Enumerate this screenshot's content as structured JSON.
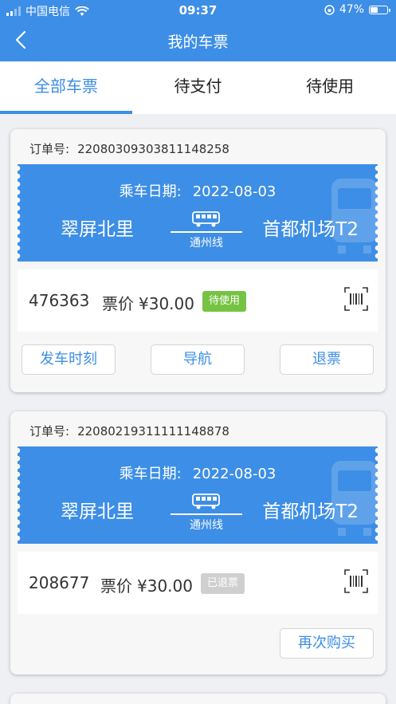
{
  "status_bar": {
    "carrier": "中国电信",
    "time": "09:37",
    "battery": "47%",
    "battery_level": 0.47
  },
  "header": {
    "title": "我的车票",
    "back_icon": "chevron-left-icon"
  },
  "tabs": [
    {
      "label": "全部车票",
      "active": true
    },
    {
      "label": "待支付",
      "active": false
    },
    {
      "label": "待使用",
      "active": false
    }
  ],
  "orders": [
    {
      "order_label": "订单号:",
      "order_no": "22080309303811148258",
      "date_label": "乘车日期:",
      "date": "2022-08-03",
      "from": "翠屏北里",
      "to": "首都机场T2",
      "line": "通州线",
      "code": "476363",
      "price_label": "票价",
      "price": "¥30.00",
      "status": "待使用",
      "status_color": "#76c343",
      "buttons": [
        "发车时刻",
        "导航",
        "退票"
      ]
    },
    {
      "order_label": "订单号:",
      "order_no": "22080219311111148878",
      "date_label": "乘车日期:",
      "date": "2022-08-03",
      "from": "翠屏北里",
      "to": "首都机场T2",
      "line": "通州线",
      "code": "208677",
      "price_label": "票价",
      "price": "¥30.00",
      "status": "已退票",
      "status_color": "#cfcfcf",
      "buttons": [
        "再次购买"
      ]
    }
  ],
  "colors": {
    "primary": "#3d8ee6",
    "background": "#eef0f3"
  }
}
